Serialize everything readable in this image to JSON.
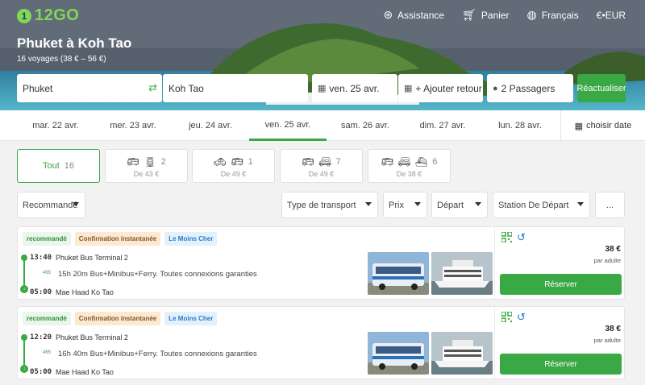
{
  "header": {
    "logo": "12GO",
    "nav": [
      {
        "icon": "lifebuoy-icon",
        "label": "Assistance"
      },
      {
        "icon": "cart-icon",
        "label": "Panier"
      },
      {
        "icon": "globe-icon",
        "label": "Français"
      },
      {
        "icon": "currency-icon",
        "label": "€•EUR"
      }
    ],
    "title": "Phuket à Koh Tao",
    "subtitle": "16 voyages (38 € – 56 €)"
  },
  "search": {
    "from": "Phuket",
    "to": "Koh Tao",
    "date": "ven. 25 avr.",
    "return": "+ Ajouter retour",
    "passengers": "2 Passagers",
    "refresh_label": "Réactualiser"
  },
  "dates": {
    "tabs": [
      "mar. 22 avr.",
      "mer. 23 avr.",
      "jeu. 24 avr.",
      "ven. 25 avr.",
      "sam. 26 avr.",
      "dim. 27 avr.",
      "lun. 28 avr."
    ],
    "active_index": 3,
    "choose_label": "choisir date"
  },
  "modes": {
    "all": {
      "label": "Tout",
      "count": "16"
    },
    "cards": [
      {
        "icons": "bus-icon train-icon",
        "count": "2",
        "price": "De 43 €"
      },
      {
        "icons": "taxi-icon bus-icon",
        "count": "1",
        "price": "De 49 €"
      },
      {
        "icons": "bus-icon minibus-icon",
        "count": "7",
        "price": "De 49 €"
      },
      {
        "icons": "bus-icon minibus-icon ferry-icon",
        "count": "6",
        "price": "De 38 €"
      }
    ]
  },
  "filters": {
    "sort": "Recommandé",
    "transport": "Type de transport",
    "price": "Prix",
    "departure": "Départ",
    "station": "Station De Départ",
    "more": "..."
  },
  "results": [
    {
      "badges": [
        "recommandé",
        "Confirmation instantanée",
        "Le Moins Cher"
      ],
      "dep_time": "13:40",
      "dep_station": "Phuket Bus Terminal 2",
      "duration": "15h 20m Bus+Minibus+Ferry. Toutes connexions garanties",
      "arr_time": "05:00",
      "arr_station": "Mae Haad Ko Tao",
      "price": "38 €",
      "per": "par adulte",
      "book": "Réserver"
    },
    {
      "badges": [
        "recommandé",
        "Confirmation instantanée",
        "Le Moins Cher"
      ],
      "dep_time": "12:20",
      "dep_station": "Phuket Bus Terminal 2",
      "duration": "16h 40m Bus+Minibus+Ferry. Toutes connexions garanties",
      "arr_time": "05:00",
      "arr_station": "Mae Haad Ko Tao",
      "price": "38 €",
      "per": "par adulte",
      "book": "Réserver"
    }
  ]
}
